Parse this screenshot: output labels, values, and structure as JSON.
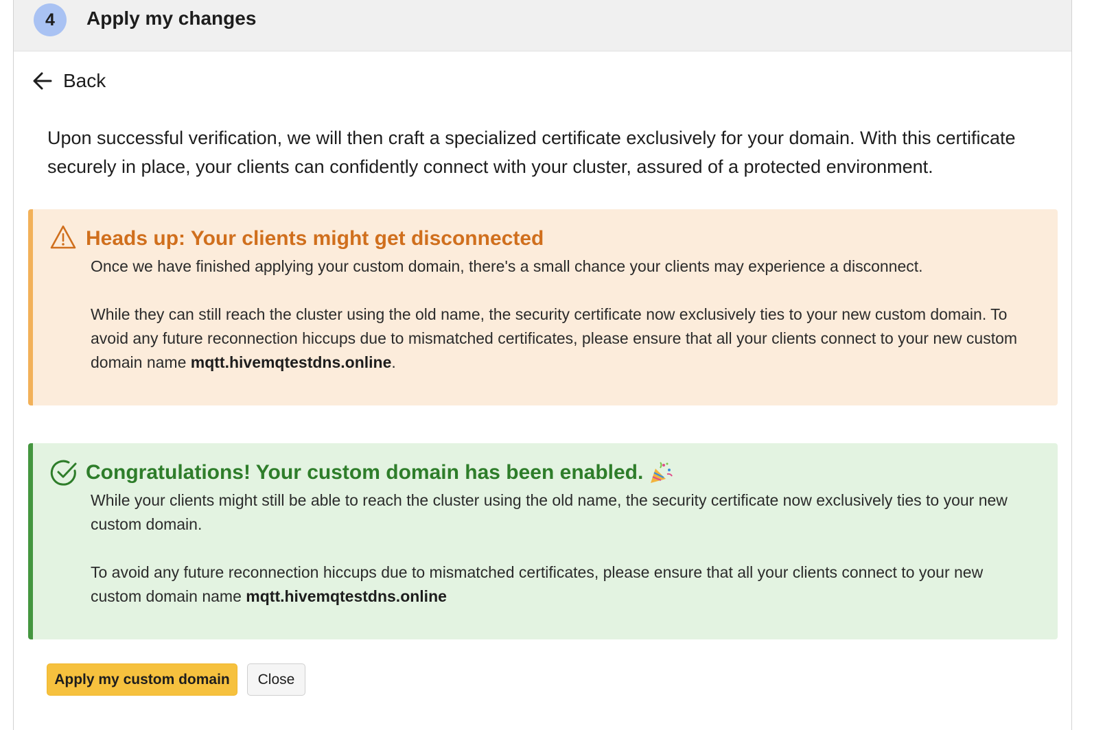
{
  "step": {
    "number": "4",
    "title": "Apply my changes"
  },
  "back": {
    "label": "Back",
    "icon": "arrow-left-icon"
  },
  "intro_text": "Upon successful verification, we will then craft a specialized certificate exclusively for your domain. With this certificate securely in place, your clients can confidently connect with your cluster, assured of a protected environment.",
  "warning": {
    "icon": "warning-triangle-icon",
    "title": "Heads up: Your clients might get disconnected",
    "paragraph1": "Once we have finished applying your custom domain, there's a small chance your clients may experience a disconnect.",
    "paragraph2_prefix": "While they can still reach the cluster using the old name, the security certificate now exclusively ties to your new custom domain. To avoid any future reconnection hiccups due to mismatched certificates, please ensure that all your clients connect to your new custom domain name ",
    "domain": "mqtt.hivemqtestdns.online",
    "paragraph2_suffix": "."
  },
  "success": {
    "icon": "check-circle-icon",
    "title": "Congratulations! Your custom domain has been enabled.",
    "emoji_icon": "party-popper-icon",
    "paragraph1": "While your clients might still be able to reach the cluster using the old name, the security certificate now exclusively ties to your new custom domain.",
    "paragraph2_prefix": "To avoid any future reconnection hiccups due to mismatched certificates, please ensure that all your clients connect to your new custom domain name ",
    "domain": "mqtt.hivemqtestdns.online"
  },
  "buttons": {
    "apply": "Apply my custom domain",
    "close": "Close"
  },
  "colors": {
    "step_badge": "#a9c2f3",
    "warning_bg": "#fcecdb",
    "warning_accent": "#f2b159",
    "warning_title": "#d06f1d",
    "success_bg": "#e3f3e1",
    "success_accent": "#44963f",
    "success_title": "#2e7d2a",
    "primary_button": "#f6c13e"
  }
}
